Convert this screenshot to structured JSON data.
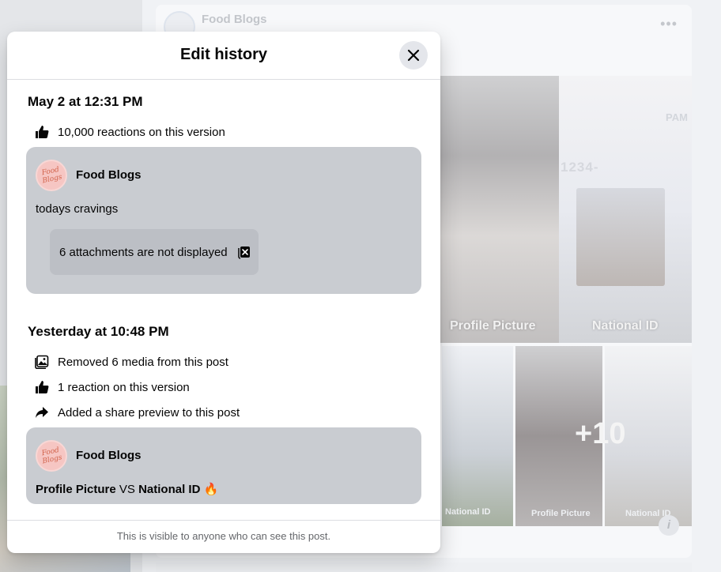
{
  "background": {
    "author": "Food Blogs",
    "number_text": "1234-",
    "pam": "PAM",
    "labels": {
      "profile_picture": "Profile Picture",
      "national_id": "National ID",
      "small_national_id": "National ID",
      "small_profile_picture": "Profile Picture",
      "small_national_id_2": "National ID"
    },
    "more_count": "+10",
    "info_icon": "i"
  },
  "modal": {
    "title": "Edit history",
    "close_icon": "close-icon",
    "versions": [
      {
        "date": "May 2 at 12:31 PM",
        "changes": [
          {
            "icon": "thumbs-up-icon",
            "text": "10,000 reactions on this version"
          }
        ],
        "post": {
          "author": "Food Blogs",
          "avatar_text": "Food Blogs",
          "text": "todays cravings",
          "attachments_notice": "6 attachments are not displayed",
          "attachments_icon": "hidden-media-icon"
        }
      },
      {
        "date": "Yesterday at 10:48 PM",
        "changes": [
          {
            "icon": "photo-icon",
            "text": "Removed 6 media from this post"
          },
          {
            "icon": "thumbs-up-icon",
            "text": "1 reaction on this version"
          },
          {
            "icon": "share-icon",
            "text": "Added a share preview to this post"
          }
        ],
        "post": {
          "author": "Food Blogs",
          "avatar_text": "Food Blogs",
          "text_part1": "Profile Picture",
          "text_vs": " VS ",
          "text_part2": "National ID",
          "emoji": "🔥"
        }
      }
    ],
    "footer": "This is visible to anyone who can see this post."
  },
  "colors": {
    "card_bg": "#c9ccd1",
    "close_btn_bg": "#e4e6eb",
    "secondary_text": "#65676b"
  }
}
